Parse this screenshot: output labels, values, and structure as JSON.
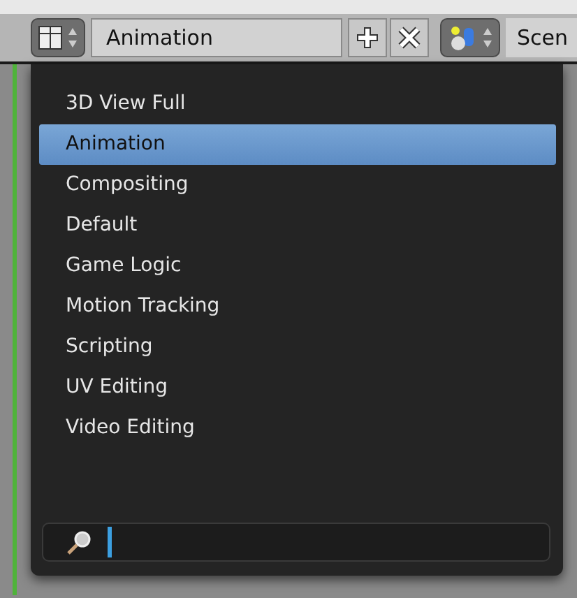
{
  "header": {
    "layout_name": "Animation",
    "scene_name": "Scen"
  },
  "menu": {
    "items": [
      {
        "label": "3D View Full",
        "selected": false
      },
      {
        "label": "Animation",
        "selected": true
      },
      {
        "label": "Compositing",
        "selected": false
      },
      {
        "label": "Default",
        "selected": false
      },
      {
        "label": "Game Logic",
        "selected": false
      },
      {
        "label": "Motion Tracking",
        "selected": false
      },
      {
        "label": "Scripting",
        "selected": false
      },
      {
        "label": "UV Editing",
        "selected": false
      },
      {
        "label": "Video Editing",
        "selected": false
      }
    ]
  }
}
